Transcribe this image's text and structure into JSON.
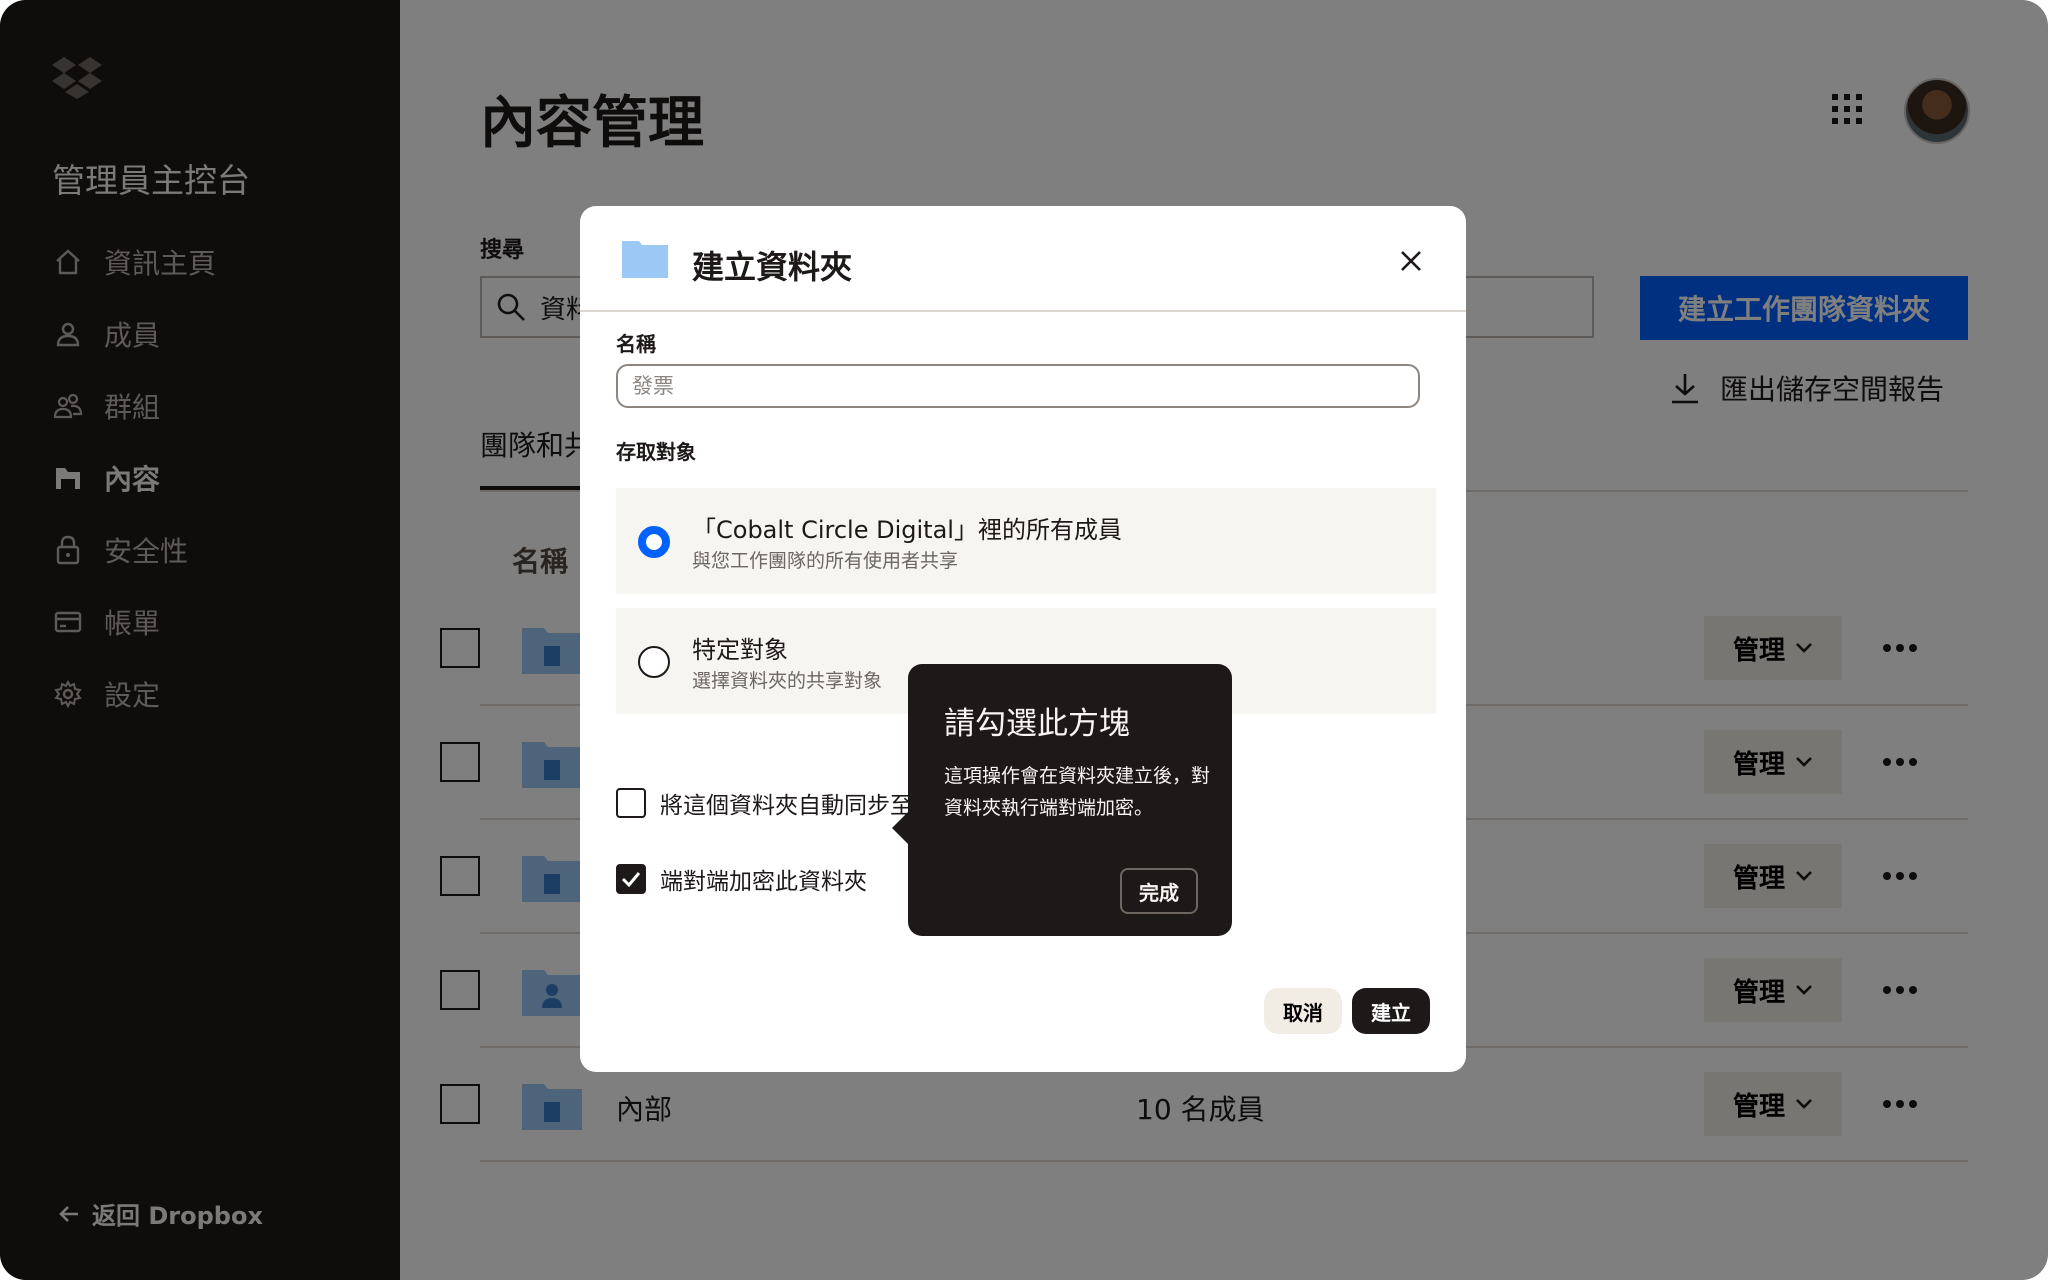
{
  "sidebar": {
    "console_title": "管理員主控台",
    "items": [
      {
        "label": "資訊主頁",
        "icon": "home-icon"
      },
      {
        "label": "成員",
        "icon": "person-icon"
      },
      {
        "label": "群組",
        "icon": "group-icon"
      },
      {
        "label": "內容",
        "icon": "folder-icon",
        "active": true
      },
      {
        "label": "安全性",
        "icon": "lock-icon"
      },
      {
        "label": "帳單",
        "icon": "card-icon"
      },
      {
        "label": "設定",
        "icon": "gear-icon"
      }
    ],
    "back_link": "返回 Dropbox"
  },
  "main": {
    "title": "內容管理",
    "search_label": "搜尋",
    "search_value": "資料",
    "create_team_folder": "建立工作團隊資料夾",
    "export_report": "匯出儲存空間報告",
    "tab_label": "團隊和共",
    "column_name": "名稱",
    "rows": [
      {
        "name": "",
        "members": "",
        "manage": "管理"
      },
      {
        "name": "",
        "members": "",
        "manage": "管理"
      },
      {
        "name": "",
        "members": "",
        "manage": "管理"
      },
      {
        "name": "",
        "members": "",
        "manage": "管理"
      },
      {
        "name": "內部",
        "members": "10 名成員",
        "manage": "管理"
      }
    ]
  },
  "modal": {
    "title": "建立資料夾",
    "name_label": "名稱",
    "name_placeholder": "發票",
    "access_label": "存取對象",
    "options": [
      {
        "title": "「Cobalt Circle Digital」裡的所有成員",
        "subtitle": "與您工作團隊的所有使用者共享",
        "selected": true
      },
      {
        "title": "特定對象",
        "subtitle": "選擇資料夾的共享對象",
        "selected": false
      }
    ],
    "sync_label": "將這個資料夾自動同步至",
    "encrypt_label": "端對端加密此資料夾",
    "cancel": "取消",
    "create": "建立"
  },
  "tooltip": {
    "title": "請勾選此方塊",
    "body": "這項操作會在資料夾建立後，對資料夾執行端對端加密。",
    "done": "完成"
  },
  "colors": {
    "accent_blue": "#0061fe",
    "sidebar_bg": "#1e1919",
    "folder_blue": "#9cc8f5"
  }
}
